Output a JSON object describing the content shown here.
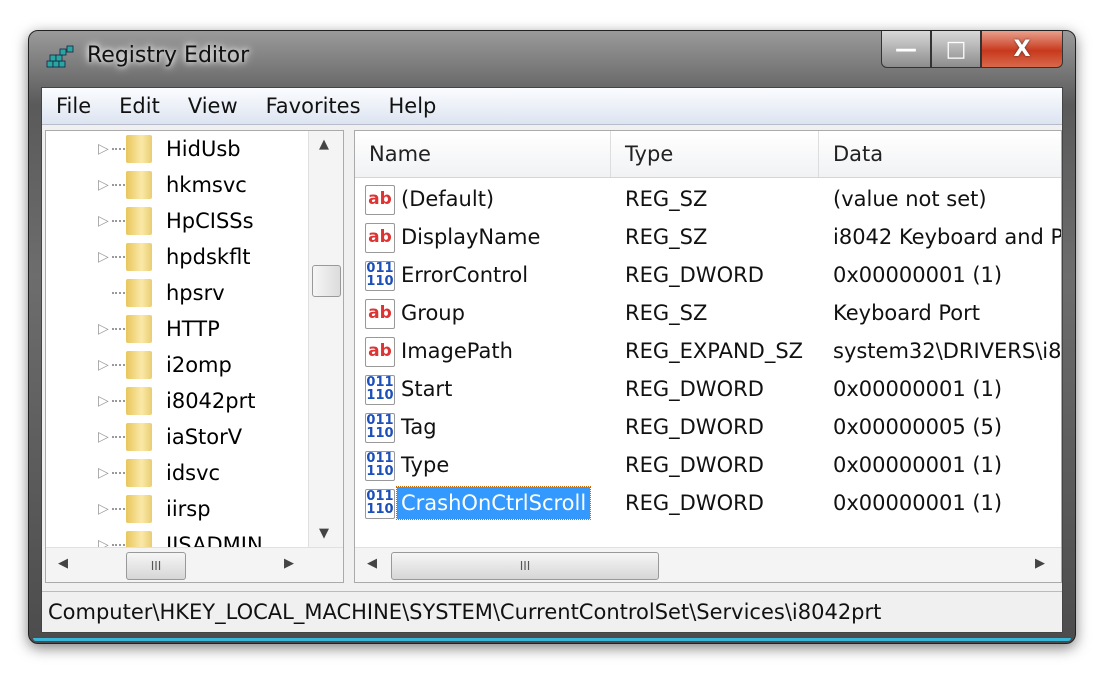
{
  "window": {
    "title": "Registry Editor",
    "minimize": "—",
    "maximize": "□",
    "close": "X"
  },
  "menu": [
    "File",
    "Edit",
    "View",
    "Favorites",
    "Help"
  ],
  "tree": {
    "items": [
      {
        "label": "HidUsb",
        "expandable": true
      },
      {
        "label": "hkmsvc",
        "expandable": true
      },
      {
        "label": "HpCISSs",
        "expandable": true
      },
      {
        "label": "hpdskflt",
        "expandable": true
      },
      {
        "label": "hpsrv",
        "expandable": false
      },
      {
        "label": "HTTP",
        "expandable": true
      },
      {
        "label": "i2omp",
        "expandable": true
      },
      {
        "label": "i8042prt",
        "expandable": true
      },
      {
        "label": "iaStorV",
        "expandable": true
      },
      {
        "label": "idsvc",
        "expandable": true
      },
      {
        "label": "iirsp",
        "expandable": true
      },
      {
        "label": "IISADMIN",
        "expandable": true
      }
    ],
    "scroll_grip": "III"
  },
  "list": {
    "columns": [
      "Name",
      "Type",
      "Data"
    ],
    "rows": [
      {
        "name": "(Default)",
        "type": "REG_SZ",
        "data": "(value not set)",
        "icon": "string-value-icon"
      },
      {
        "name": "DisplayName",
        "type": "REG_SZ",
        "data": "i8042 Keyboard and P",
        "icon": "string-value-icon"
      },
      {
        "name": "ErrorControl",
        "type": "REG_DWORD",
        "data": "0x00000001 (1)",
        "icon": "binary-value-icon"
      },
      {
        "name": "Group",
        "type": "REG_SZ",
        "data": "Keyboard Port",
        "icon": "string-value-icon"
      },
      {
        "name": "ImagePath",
        "type": "REG_EXPAND_SZ",
        "data": "system32\\DRIVERS\\i8",
        "icon": "string-value-icon"
      },
      {
        "name": "Start",
        "type": "REG_DWORD",
        "data": "0x00000001 (1)",
        "icon": "binary-value-icon"
      },
      {
        "name": "Tag",
        "type": "REG_DWORD",
        "data": "0x00000005 (5)",
        "icon": "binary-value-icon"
      },
      {
        "name": "Type",
        "type": "REG_DWORD",
        "data": "0x00000001 (1)",
        "icon": "binary-value-icon"
      },
      {
        "name": "CrashOnCtrlScroll",
        "type": "REG_DWORD",
        "data": "0x00000001 (1)",
        "icon": "binary-value-icon",
        "selected": true
      }
    ],
    "scroll_grip": "III"
  },
  "status": "Computer\\HKEY_LOCAL_MACHINE\\SYSTEM\\CurrentControlSet\\Services\\i8042prt",
  "colors": {
    "selection": "#3399ff",
    "close_button": "#c8391d",
    "frame_accent": "#3ab7d8"
  }
}
